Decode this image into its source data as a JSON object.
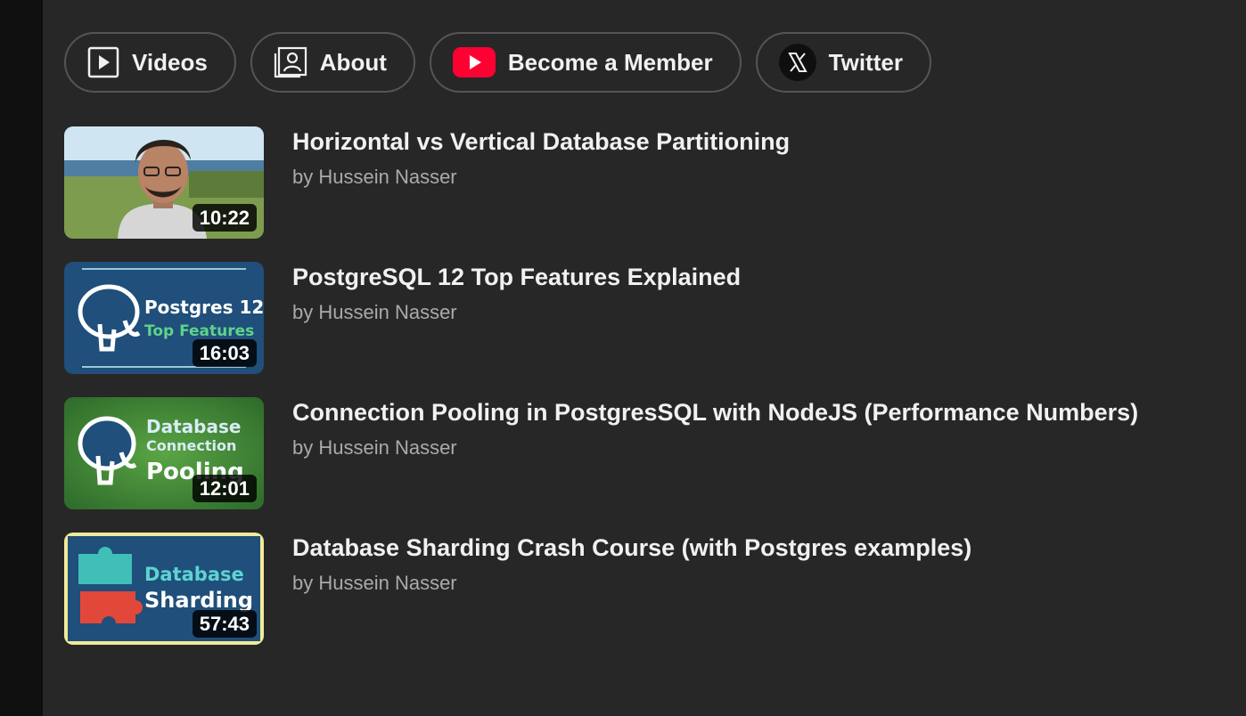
{
  "chips": [
    {
      "label": "Videos",
      "icon": "play-square-icon"
    },
    {
      "label": "About",
      "icon": "contact-card-icon"
    },
    {
      "label": "Become a Member",
      "icon": "youtube-icon"
    },
    {
      "label": "Twitter",
      "icon": "x-logo-icon"
    }
  ],
  "videos": [
    {
      "title": "Horizontal vs Vertical Database Partitioning",
      "author": "by Hussein Nasser",
      "duration": "10:22"
    },
    {
      "title": "PostgreSQL 12 Top Features Explained",
      "author": "by Hussein Nasser",
      "duration": "16:03",
      "thumb_text": [
        "Postgres 12",
        "Top Features"
      ]
    },
    {
      "title": "Connection Pooling in PostgresSQL with NodeJS (Performance Numbers)",
      "author": "by Hussein Nasser",
      "duration": "12:01",
      "thumb_text": [
        "Database",
        "Connection",
        "Pooling"
      ]
    },
    {
      "title": "Database Sharding Crash Course (with Postgres examples)",
      "author": "by Hussein Nasser",
      "duration": "57:43",
      "thumb_text": [
        "Database",
        "Sharding"
      ]
    }
  ],
  "colors": {
    "background": "#272727",
    "youtube_red": "#ff0033",
    "thumb_blue": "#1f4f7a",
    "thumb_green": "#3f8a3a"
  }
}
